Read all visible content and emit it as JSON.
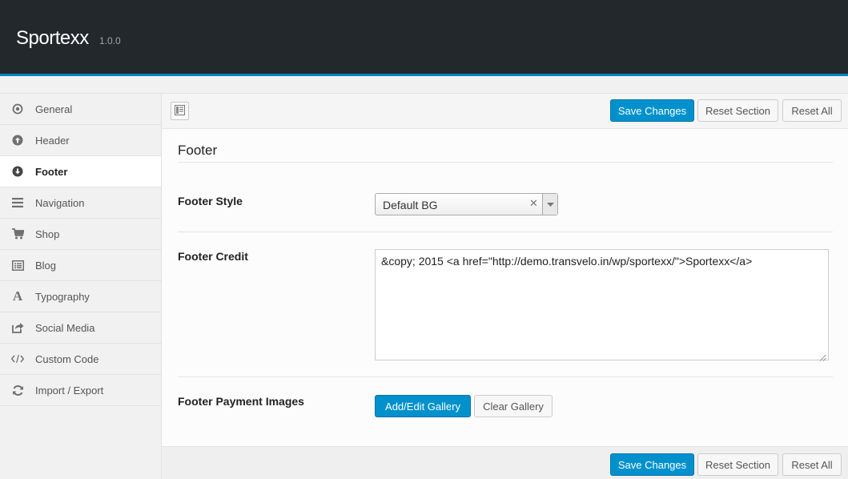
{
  "header": {
    "title": "Sportexx",
    "version": "1.0.0"
  },
  "sidebar": {
    "items": [
      {
        "label": "General",
        "icon": "radio-circle-icon"
      },
      {
        "label": "Header",
        "icon": "arrow-up-circle-icon"
      },
      {
        "label": "Footer",
        "icon": "arrow-down-circle-icon",
        "active": true
      },
      {
        "label": "Navigation",
        "icon": "hamburger-icon"
      },
      {
        "label": "Shop",
        "icon": "cart-icon"
      },
      {
        "label": "Blog",
        "icon": "list-icon"
      },
      {
        "label": "Typography",
        "icon": "letter-a-icon"
      },
      {
        "label": "Social Media",
        "icon": "share-icon"
      },
      {
        "label": "Custom Code",
        "icon": "code-icon"
      },
      {
        "label": "Import / Export",
        "icon": "refresh-icon"
      }
    ]
  },
  "toolbar": {
    "save_label": "Save Changes",
    "reset_section_label": "Reset Section",
    "reset_all_label": "Reset All"
  },
  "section": {
    "title": "Footer",
    "fields": {
      "footer_style": {
        "label": "Footer Style",
        "value": "Default BG"
      },
      "footer_credit": {
        "label": "Footer Credit",
        "value": "&copy; 2015 <a href=\"http://demo.transvelo.in/wp/sportexx/\">Sportexx</a>"
      },
      "footer_payment_images": {
        "label": "Footer Payment Images",
        "add_label": "Add/Edit Gallery",
        "clear_label": "Clear Gallery"
      }
    }
  },
  "colors": {
    "topbar": "#23282d",
    "accent": "#0085ba",
    "primary_button": "#0091cd"
  }
}
